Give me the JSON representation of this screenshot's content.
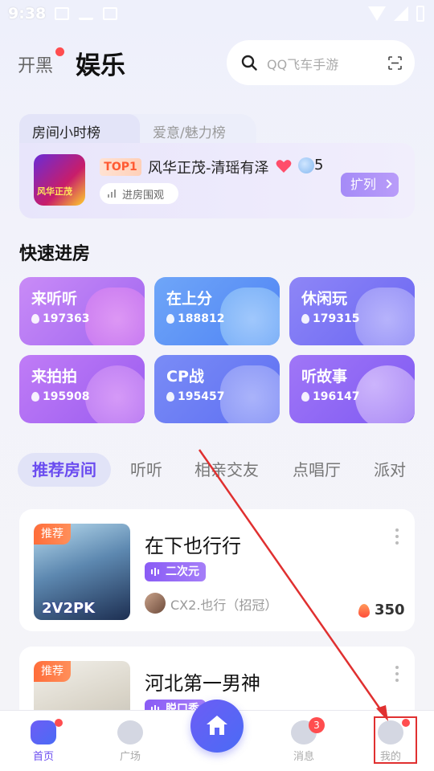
{
  "status_bar": {
    "time": "9:38"
  },
  "header": {
    "tab_kaihei": "开黑",
    "tab_yule": "娱乐",
    "search_placeholder": "QQ飞车手游"
  },
  "rank": {
    "tab_active": "房间小时榜",
    "tab_inactive": "爱意/魅力榜",
    "thumb_text": "风华正茂",
    "top_badge": "TOP1",
    "room_title": "风华正茂-清瑶有泽",
    "count": "5",
    "watch_label": "进房围观",
    "expand_label": "扩列"
  },
  "quick": {
    "title": "快速进房",
    "cards": [
      {
        "label": "来听听",
        "count": "197363",
        "color1": "#c98bf7",
        "color2": "#a066f0"
      },
      {
        "label": "在上分",
        "count": "188812",
        "color1": "#6fa6f8",
        "color2": "#4f83f4"
      },
      {
        "label": "休闲玩",
        "count": "179315",
        "color1": "#8e86f7",
        "color2": "#6a66f2"
      },
      {
        "label": "来拍拍",
        "count": "195908",
        "color1": "#c07cf6",
        "color2": "#9a5cf0"
      },
      {
        "label": "CP战",
        "count": "195457",
        "color1": "#7a8cf6",
        "color2": "#5e6ff2"
      },
      {
        "label": "听故事",
        "count": "196147",
        "color1": "#a076f7",
        "color2": "#7f5af2"
      }
    ]
  },
  "categories": [
    "推荐房间",
    "听听",
    "相亲交友",
    "点唱厅",
    "派对"
  ],
  "rooms": [
    {
      "badge": "推荐",
      "banner": "2V2PK",
      "name": "在下也行行",
      "tag": "二次元",
      "host": "CX2.也行（招冠）",
      "hot": "350"
    },
    {
      "badge": "推荐",
      "banner": "",
      "name": "河北第一男神",
      "tag": "脱口秀",
      "host": "",
      "hot": ""
    }
  ],
  "bottom_nav": {
    "home": "首页",
    "square": "广场",
    "messages": "消息",
    "messages_badge": "3",
    "mine": "我的"
  },
  "colors": {
    "accent": "#6a4cf0",
    "annotation_red": "#e03030"
  }
}
